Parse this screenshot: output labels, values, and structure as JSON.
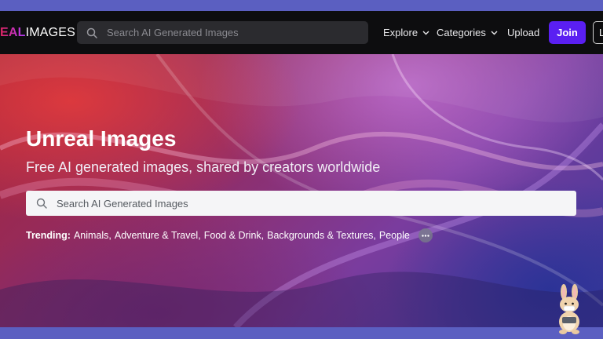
{
  "brand": {
    "logo_part1": "EAL",
    "logo_part2": "IMAGES"
  },
  "nav": {
    "search_placeholder": "Search AI Generated Images",
    "explore_label": "Explore",
    "categories_label": "Categories",
    "upload_label": "Upload",
    "join_label": "Join",
    "login_label": "L"
  },
  "hero": {
    "title": "Unreal Images",
    "subtitle": "Free AI generated images, shared by creators worldwide",
    "search_placeholder": "Search AI Generated Images",
    "trending_label": "Trending:",
    "trending_items": [
      "Animals",
      "Adventure & Travel",
      "Food & Drink",
      "Backgrounds & Textures",
      "People"
    ]
  },
  "icons": [
    "search-icon",
    "chevron-down-icon",
    "more-dots-icon",
    "rabbit-mascot-icon"
  ],
  "colors": {
    "join_bg": "#5a1ff2",
    "navbar_bg": "#0d0d0f",
    "frame": "#5b5fc1"
  }
}
